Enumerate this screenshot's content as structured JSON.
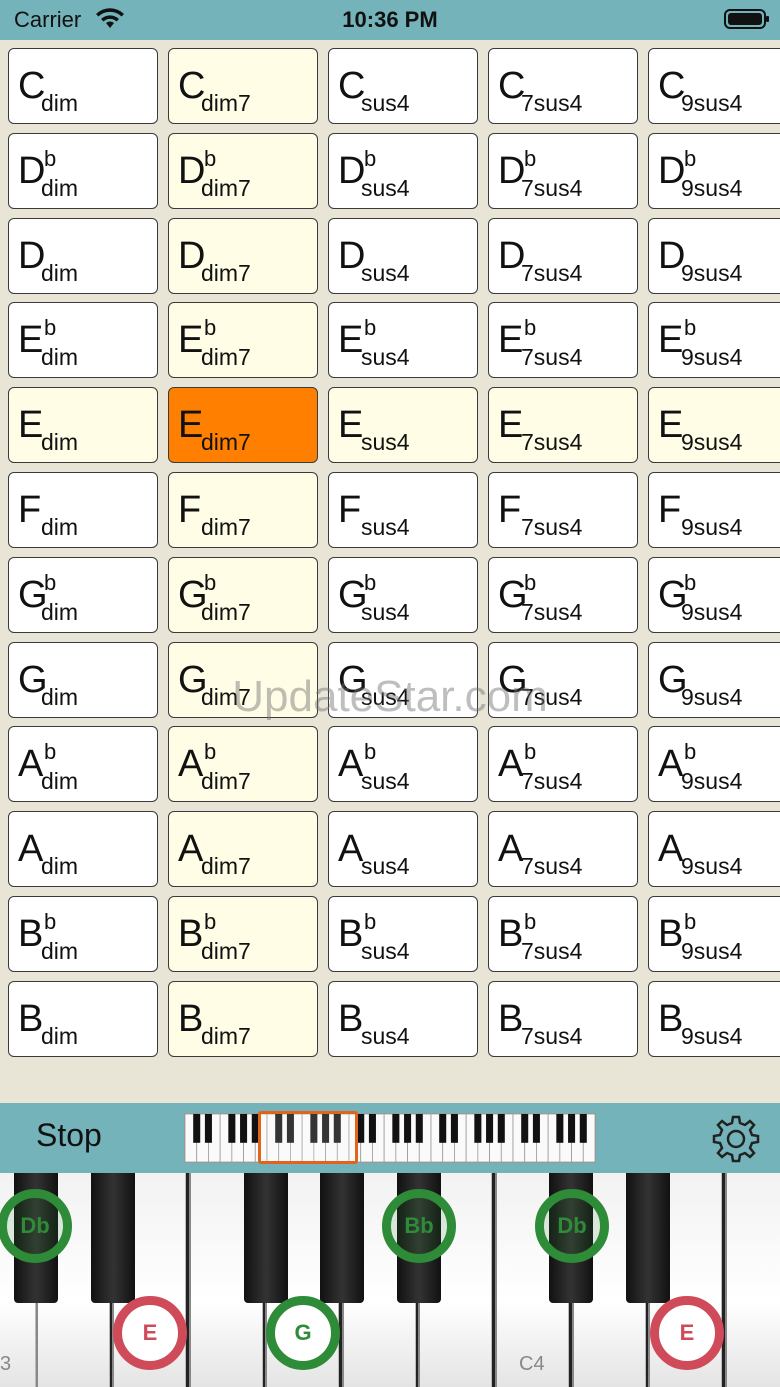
{
  "status_bar": {
    "carrier": "Carrier",
    "time": "10:36 PM"
  },
  "chords": {
    "flat_symbol": "b",
    "roots": [
      {
        "name": "C",
        "flat": false
      },
      {
        "name": "D",
        "flat": true
      },
      {
        "name": "D",
        "flat": false
      },
      {
        "name": "E",
        "flat": true
      },
      {
        "name": "E",
        "flat": false
      },
      {
        "name": "F",
        "flat": false
      },
      {
        "name": "G",
        "flat": true
      },
      {
        "name": "G",
        "flat": false
      },
      {
        "name": "A",
        "flat": true
      },
      {
        "name": "A",
        "flat": false
      },
      {
        "name": "B",
        "flat": true
      },
      {
        "name": "B",
        "flat": false
      }
    ],
    "qualities": [
      "dim",
      "dim7",
      "sus4",
      "7sus4",
      "9sus4"
    ],
    "highlighted_row": 4,
    "selected": {
      "row": 4,
      "col": 1
    },
    "highlight_color": "#fffde5",
    "selected_color": "#ff8000"
  },
  "watermark": "UpdateStar.com",
  "toolbar": {
    "stop_label": "Stop"
  },
  "piano": {
    "octave_labels": [
      "3",
      "C4"
    ],
    "notes_marked": [
      {
        "label": "Db",
        "color": "green"
      },
      {
        "label": "E",
        "color": "red"
      },
      {
        "label": "G",
        "color": "green"
      },
      {
        "label": "Bb",
        "color": "green"
      },
      {
        "label": "Db",
        "color": "green"
      },
      {
        "label": "E",
        "color": "red"
      }
    ]
  }
}
